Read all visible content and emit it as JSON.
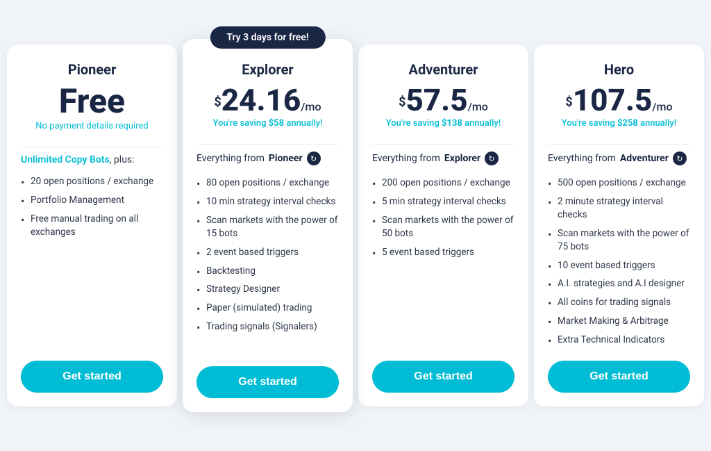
{
  "plans": [
    {
      "id": "pioneer",
      "name": "Pioneer",
      "price_type": "free",
      "price_display": "Free",
      "no_payment": "No payment details required",
      "saving": null,
      "try_banner": null,
      "everything_from": null,
      "intro": "Unlimited Copy Bots, plus:",
      "features": [
        "20 open positions / exchange",
        "Portfolio Management",
        "Free manual trading on all exchanges"
      ],
      "cta": "Get started"
    },
    {
      "id": "explorer",
      "name": "Explorer",
      "price_type": "paid",
      "currency": "$",
      "amount": "24.16",
      "period": "/mo",
      "saving": "You're saving $58 annually!",
      "saving_amount": "$58",
      "try_banner": "Try 3 days for free!",
      "everything_from": "Pioneer",
      "intro": null,
      "features": [
        "80 open positions / exchange",
        "10 min strategy interval checks",
        "Scan markets with the power of 15 bots",
        "2 event based triggers",
        "Backtesting",
        "Strategy Designer",
        "Paper (simulated) trading",
        "Trading signals (Signalers)"
      ],
      "cta": "Get started"
    },
    {
      "id": "adventurer",
      "name": "Adventurer",
      "price_type": "paid",
      "currency": "$",
      "amount": "57.5",
      "period": "/mo",
      "saving": "You're saving $138 annually!",
      "saving_amount": "$138",
      "try_banner": null,
      "everything_from": "Explorer",
      "intro": null,
      "features": [
        "200 open positions / exchange",
        "5 min strategy interval checks",
        "Scan markets with the power of 50 bots",
        "5 event based triggers"
      ],
      "cta": "Get started"
    },
    {
      "id": "hero",
      "name": "Hero",
      "price_type": "paid",
      "currency": "$",
      "amount": "107.5",
      "period": "/mo",
      "saving": "You're saving $258 annually!",
      "saving_amount": "$258",
      "try_banner": null,
      "everything_from": "Adventurer",
      "intro": null,
      "features": [
        "500 open positions / exchange",
        "2 minute strategy interval checks",
        "Scan markets with the power of 75 bots",
        "10 event based triggers",
        "A.I. strategies and A.I designer",
        "All coins for trading signals",
        "Market Making & Arbitrage",
        "Extra Technical Indicators"
      ],
      "cta": "Get started"
    }
  ]
}
